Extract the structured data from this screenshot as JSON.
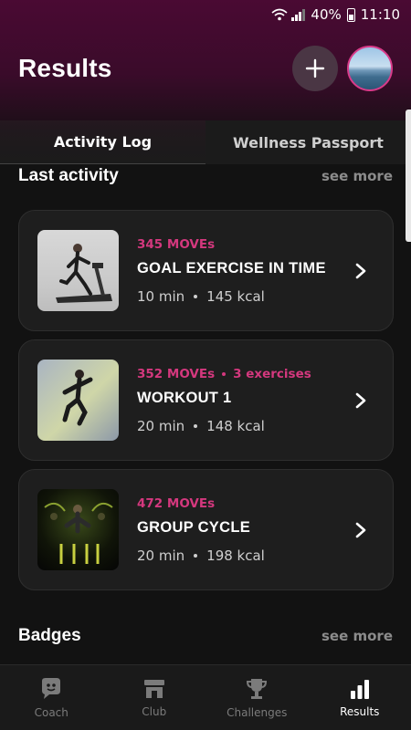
{
  "status": {
    "battery": "40%",
    "time": "11:10"
  },
  "header": {
    "title": "Results"
  },
  "tabs": [
    {
      "label": "Activity Log",
      "active": true
    },
    {
      "label": "Wellness Passport",
      "active": false
    }
  ],
  "last_activity": {
    "title": "Last activity",
    "see_more": "see more",
    "items": [
      {
        "moves": "345 MOVEs",
        "extra": "",
        "title": "GOAL EXERCISE IN TIME",
        "duration": "10 min",
        "kcal": "145 kcal",
        "thumb": "treadmill-runner"
      },
      {
        "moves": "352 MOVEs",
        "extra": "3 exercises",
        "title": "WORKOUT 1",
        "duration": "20 min",
        "kcal": "148 kcal",
        "thumb": "jumping-athlete"
      },
      {
        "moves": "472 MOVEs",
        "extra": "",
        "title": "GROUP CYCLE",
        "duration": "20 min",
        "kcal": "198 kcal",
        "thumb": "group-cycle-class"
      }
    ]
  },
  "badges": {
    "title": "Badges",
    "see_more": "see more"
  },
  "nav": [
    {
      "label": "Coach",
      "icon": "coach-icon",
      "active": false
    },
    {
      "label": "Club",
      "icon": "club-icon",
      "active": false
    },
    {
      "label": "Challenges",
      "icon": "trophy-icon",
      "active": false
    },
    {
      "label": "Results",
      "icon": "bar-chart-icon",
      "active": true
    }
  ],
  "colors": {
    "accent": "#d4387e",
    "background": "#121212",
    "card": "#1e1e1e"
  }
}
